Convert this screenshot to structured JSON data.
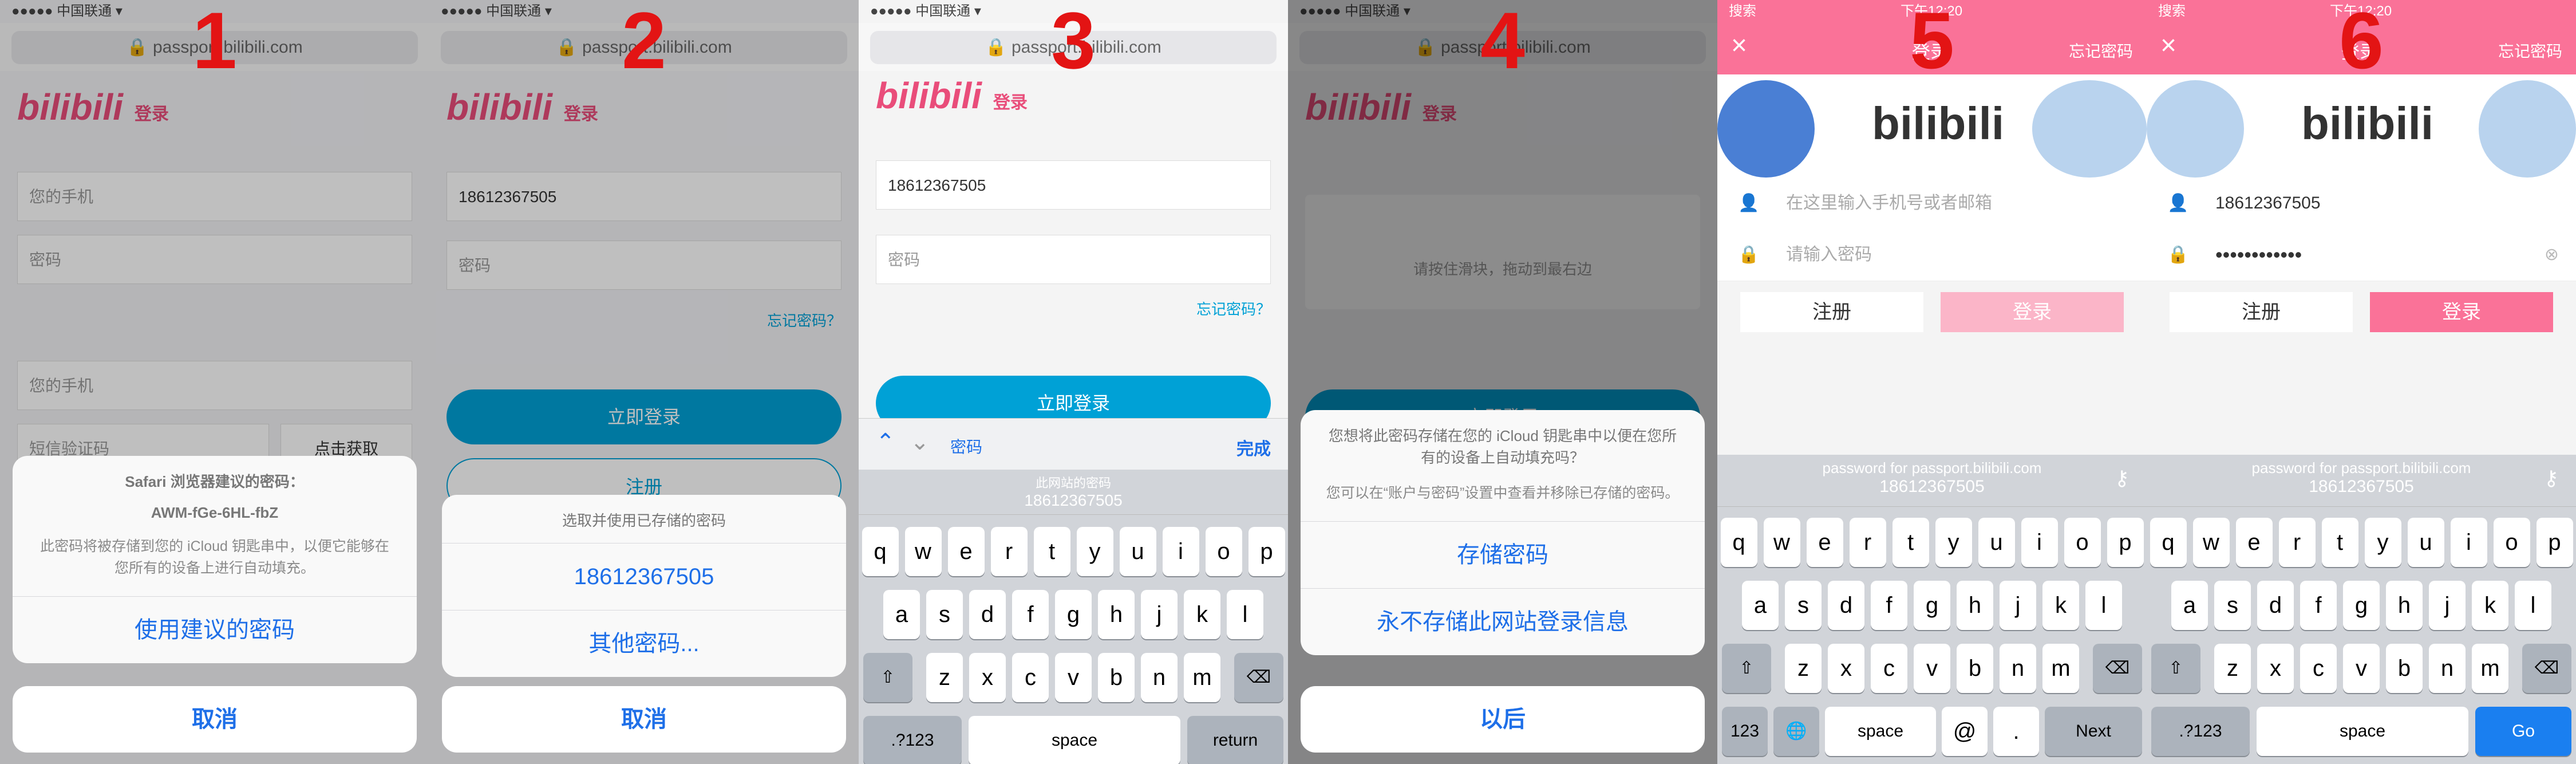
{
  "steps": [
    "1",
    "2",
    "3",
    "4",
    "5",
    "6"
  ],
  "safari": {
    "url": "passport.bilibili.com",
    "done": "完成",
    "password_label": "密码"
  },
  "web": {
    "logo_text": "bilibili",
    "login_label": "登录",
    "phone_placeholder": "您的手机",
    "sms_placeholder": "短信验证码",
    "get_code": "点击获取",
    "phone_value": "18612367505",
    "password_placeholder": "密码",
    "forgot": "忘记密码？",
    "login_now": "立即登录",
    "register": "注册",
    "slider_text": "请按住滑块，拖动到最右边"
  },
  "p1": {
    "title": "Safari 浏览器建议的密码：",
    "password": "AWM-fGe-6HL-fbZ",
    "desc": "此密码将被存储到您的 iCloud 钥匙串中，以便它能够在您所有的设备上进行自动填充。",
    "use": "使用建议的密码",
    "cancel": "取消"
  },
  "p2": {
    "title": "选取并使用已存储的密码",
    "saved": "18612367505",
    "other": "其他密码...",
    "cancel": "取消"
  },
  "p3": {
    "bar_title": "此网站的密码",
    "bar_value": "18612367505",
    "space": "space",
    "return": "return",
    "num": ".?123"
  },
  "p4": {
    "title": "您想将此密码存储在您的 iCloud 钥匙串中以便在您所有的设备上自动填充吗？",
    "desc": "您可以在“账户与密码”设置中查看并移除已存储的密码。",
    "save": "存储密码",
    "never": "永不存储此网站登录信息",
    "later": "以后"
  },
  "p5": {
    "status_left": "搜索",
    "time": "下午12:20",
    "close": "×",
    "header_title": "登录",
    "forgot": "忘记密码",
    "phone_placeholder": "在这里输入手机号或者邮箱",
    "pw_placeholder": "请输入密码",
    "register": "注册",
    "login": "登录",
    "bar_site": "password for passport.bilibili.com",
    "bar_value": "18612367505",
    "k123": "123",
    "space": "space",
    "at": "@",
    "dot": ".",
    "next": "Next"
  },
  "p6": {
    "phone_value": "18612367505",
    "pw_dots": "••••••••••••",
    "register": "注册",
    "login": "登录",
    "bar_site": "password for passport.bilibili.com",
    "bar_value": "18612367505",
    "num": ".?123",
    "space": "space",
    "go": "Go"
  },
  "keyboard": {
    "row1": [
      "q",
      "w",
      "e",
      "r",
      "t",
      "y",
      "u",
      "i",
      "o",
      "p"
    ],
    "row2": [
      "a",
      "s",
      "d",
      "f",
      "g",
      "h",
      "j",
      "k",
      "l"
    ],
    "row3": [
      "z",
      "x",
      "c",
      "v",
      "b",
      "n",
      "m"
    ]
  },
  "colors": {
    "step": "#e31414",
    "accent_blue": "#1e6fe8",
    "bili_pink": "#fa7298",
    "bili_blue": "#00a1d6"
  }
}
